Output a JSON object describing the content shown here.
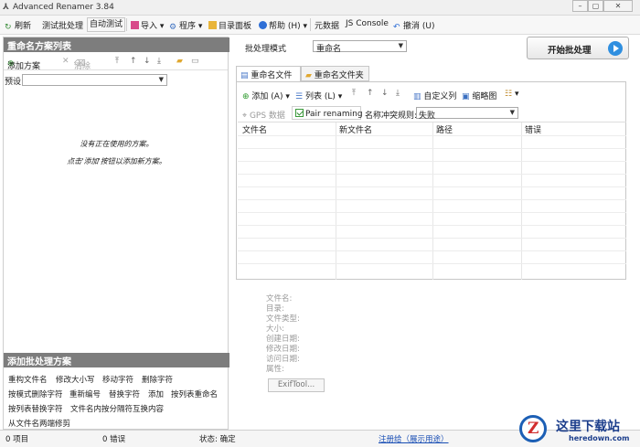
{
  "window": {
    "title": "Advanced Renamer 3.84",
    "app_icon": "AR"
  },
  "menu": {
    "refresh": "刷新",
    "test_batch": "测试批处理",
    "auto_test": "自动测试",
    "import": "导入",
    "program": "程序",
    "dir_panel": "目录面板",
    "help": "帮助 (H)",
    "metadata": "元数据",
    "js_console": "JS Console",
    "undo": "撤消 (U)"
  },
  "left": {
    "header": "重命名方案列表",
    "add_method": "添加方案",
    "clear": "清除",
    "preset_label": "预设:",
    "preset_value": "",
    "empty_line1": "没有正在使用的方案。",
    "empty_line2": "点击'添加'按钮以添加新方案。",
    "batch_header": "添加批处理方案",
    "batch_items": [
      [
        "重构文件名",
        "修改大小写",
        "移动字符",
        "删除字符"
      ],
      [
        "按模式删除字符",
        "重新编号",
        "替换字符",
        "添加",
        "按列表重命名"
      ],
      [
        "按列表替换字符",
        "文件名内按分隔符互换内容"
      ],
      [
        "从文件名两端修剪"
      ]
    ]
  },
  "right": {
    "batch_mode_label": "批处理模式",
    "batch_mode_value": "重命名",
    "start_button": "开始批处理",
    "tabs": [
      "重命名文件",
      "重命名文件夹"
    ],
    "toolbar": {
      "add": "添加 (A)",
      "list": "列表 (L)",
      "custom_columns": "自定义列",
      "thumbnails": "缩略图"
    },
    "gps_data": "GPS 数据",
    "pair_renaming": "Pair renaming",
    "conflict_label": "名称冲突规则:",
    "conflict_value": "失败",
    "columns": [
      "文件名",
      "新文件名",
      "路径",
      "错误"
    ],
    "info_labels": [
      "文件名:",
      "目录:",
      "文件类型:",
      "大小:",
      "创建日期:",
      "修改日期:",
      "访问日期:",
      "属性:"
    ],
    "exif_button": "ExifTool..."
  },
  "status": {
    "items": "0 项目",
    "errors": "0 错误",
    "state": "状态: 确定",
    "register": "注册给（展示用途）"
  },
  "watermark": {
    "text": "这里下载站",
    "url": "heredown.com",
    "logo_letter": "Z"
  },
  "colors": {
    "panel_header": "#7d7d7d",
    "accent": "#2f8fe0",
    "link": "#1a4fb5"
  }
}
